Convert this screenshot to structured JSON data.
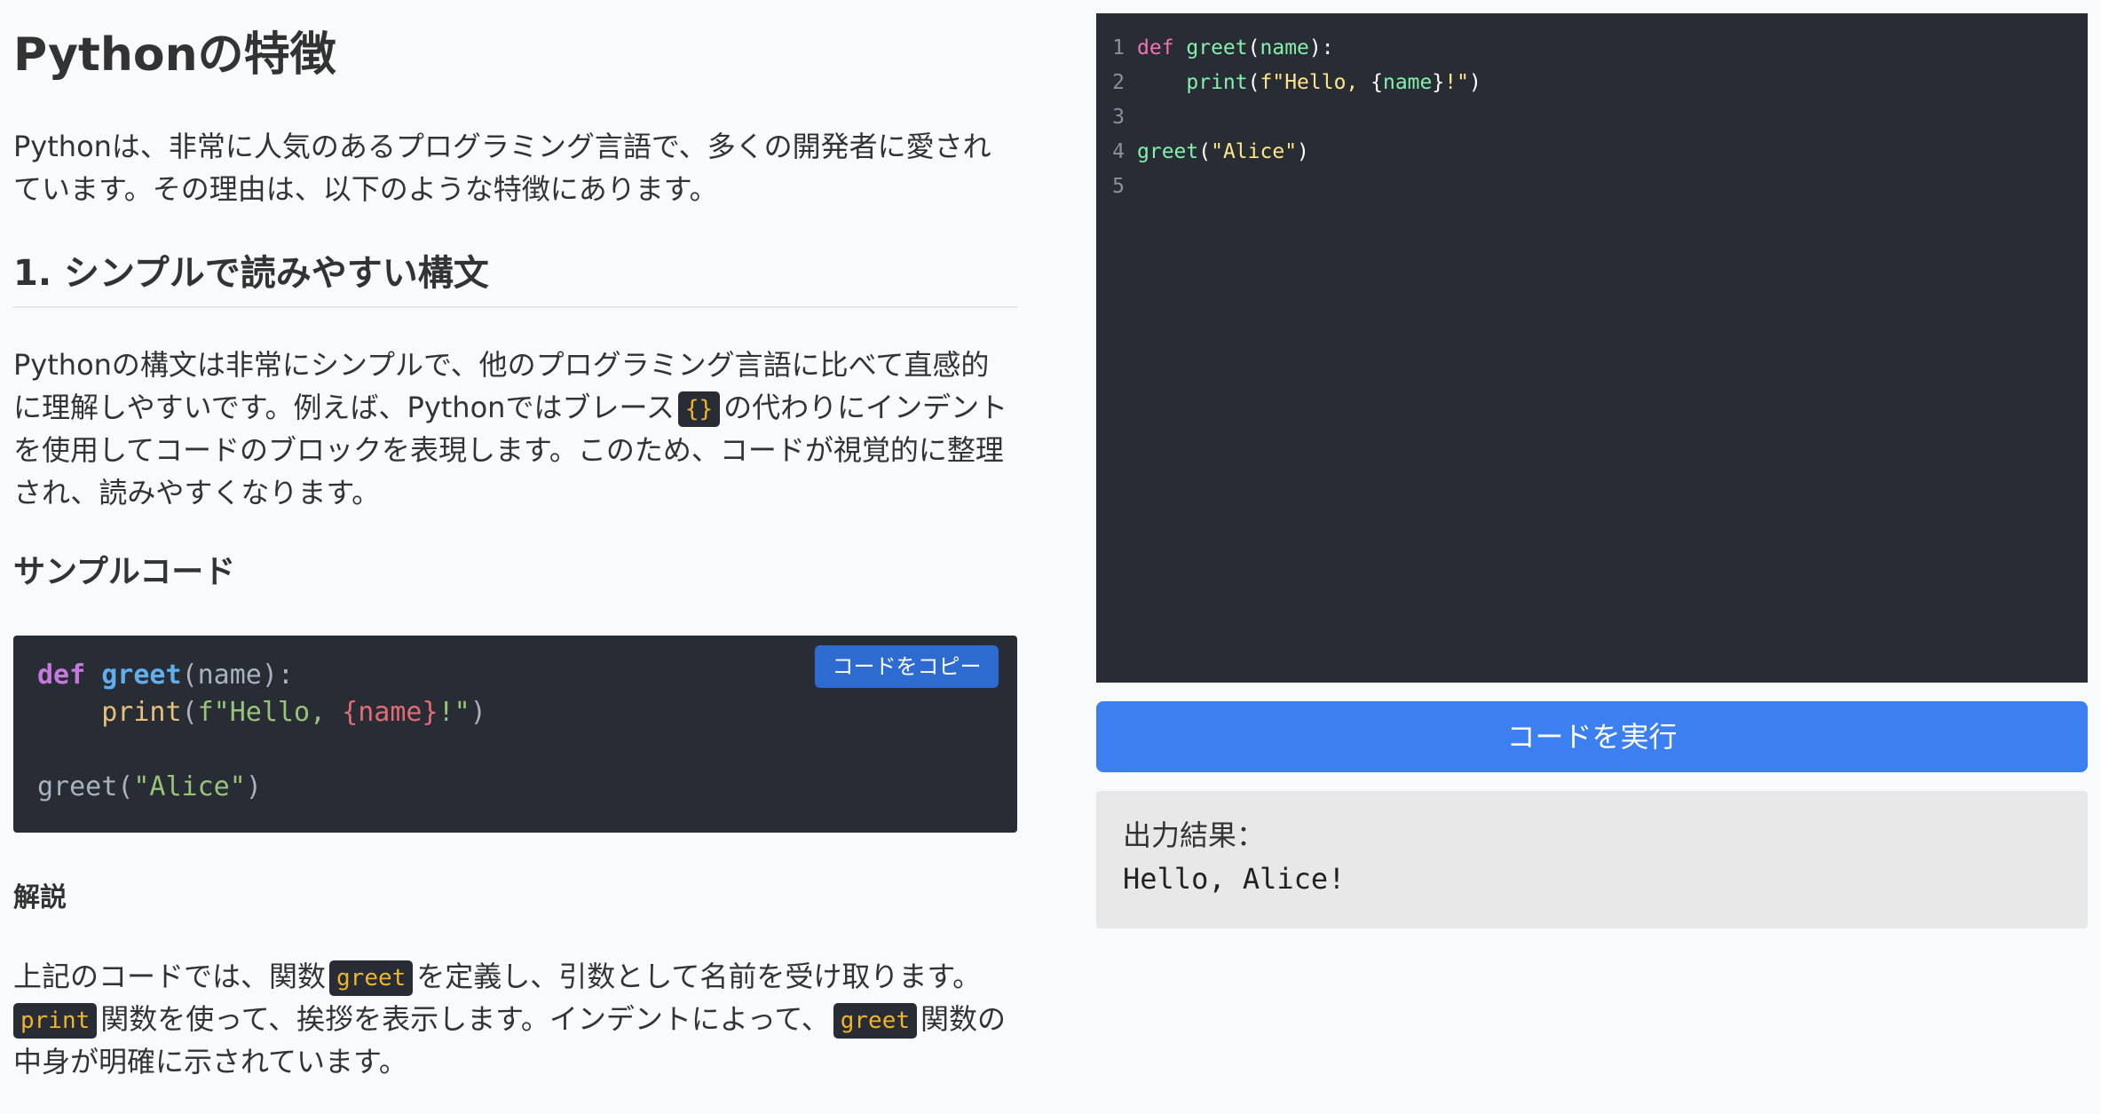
{
  "article": {
    "title": "Pythonの特徴",
    "intro": "Pythonは、非常に人気のあるプログラミング言語で、多くの開発者に愛されています。その理由は、以下のような特徴にあります。",
    "section1": {
      "heading": "1. シンプルで読みやすい構文",
      "para_before": "Pythonの構文は非常にシンプルで、他のプログラミング言語に比べて直感的に理解しやすいです。例えば、Pythonではブレース",
      "para_code": "{}",
      "para_after": "の代わりにインデントを使用してコードのブロックを表現します。このため、コードが視覚的に整理され、読みやすくなります。"
    },
    "sample": {
      "heading": "サンプルコード",
      "copy_label": "コードをコピー",
      "code": {
        "l1_def": "def",
        "l1_fn": "greet",
        "l1_rest": "(name):",
        "l2_indent": "    ",
        "l2_print": "print",
        "l2_open": "(",
        "l2_str_a": "f\"Hello, ",
        "l2_sub": "{name}",
        "l2_str_b": "!\"",
        "l2_close": ")",
        "l4_fn": "greet(",
        "l4_str": "\"Alice\"",
        "l4_close": ")"
      }
    },
    "explanation": {
      "heading": "解説",
      "t1": "上記のコードでは、関数",
      "c1": "greet",
      "t2": "を定義し、引数として名前を受け取ります。",
      "c2": "print",
      "t3": "関数を使って、挨拶を表示します。インデントによって、",
      "c3": "greet",
      "t4": "関数の中身が明確に示されています。"
    }
  },
  "editor": {
    "lines": [
      {
        "n": "1",
        "kw": "def",
        "fn": " greet",
        "p1": "(",
        "var": "name",
        "p2": "):"
      },
      {
        "n": "2",
        "indent": "    ",
        "fn": "print",
        "p1": "(",
        "str1": "f\"Hello, ",
        "p2": "{",
        "var": "name",
        "p3": "}",
        "str2": "!\"",
        "p4": ")"
      },
      {
        "n": "3"
      },
      {
        "n": "4",
        "fn": "greet",
        "p1": "(",
        "str": "\"Alice\"",
        "p2": ")"
      },
      {
        "n": "5"
      }
    ],
    "run_label": "コードを実行",
    "output_label": "出力結果：",
    "output_text": "Hello, Alice!"
  },
  "colors": {
    "run_button": "#3b7ff0",
    "copy_button": "#2d6bd0",
    "code_bg": "#282c34",
    "inline_code_fg": "#f0b429"
  }
}
